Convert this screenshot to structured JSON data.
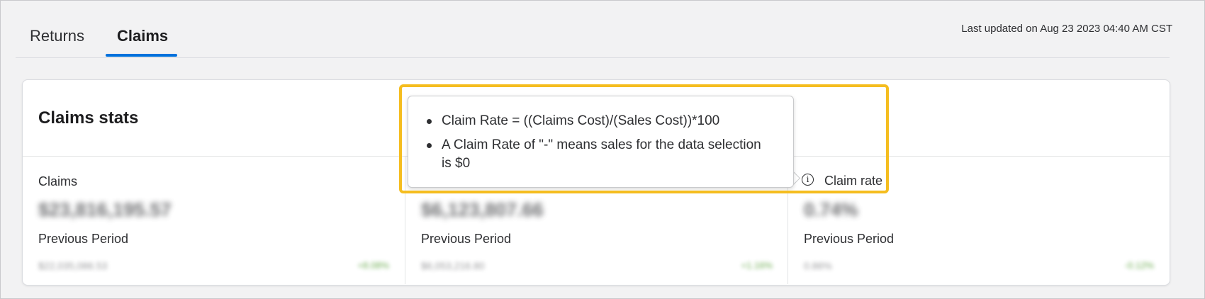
{
  "tabs": [
    {
      "label": "Returns",
      "active": false
    },
    {
      "label": "Claims",
      "active": true
    }
  ],
  "last_updated": "Last updated on Aug 23 2023 04:40 AM CST",
  "card": {
    "title": "Claims stats",
    "stats": [
      {
        "label": "Claims",
        "value": "$23,816,195.57",
        "prev_label": "Previous Period",
        "prev_value": "$22,035,086.53",
        "change": "+8.08%"
      },
      {
        "label": "",
        "value": "$6,123,807.66",
        "prev_label": "Previous Period",
        "prev_value": "$6,053,216.80",
        "change": "+1.16%"
      },
      {
        "label": "Claim rate",
        "value": "0.74%",
        "prev_label": "Previous Period",
        "prev_value": "0.86%",
        "change": "-0.12%"
      }
    ]
  },
  "tooltip": {
    "items": [
      "Claim Rate = ((Claims Cost)/(Sales Cost))*100",
      "A Claim Rate of \"-\" means sales for the data selection is $0"
    ]
  },
  "icons": {
    "info": "info-icon"
  },
  "colors": {
    "accent": "#0071dc",
    "highlight": "#f5bd1f",
    "positive": "#2a8703"
  }
}
